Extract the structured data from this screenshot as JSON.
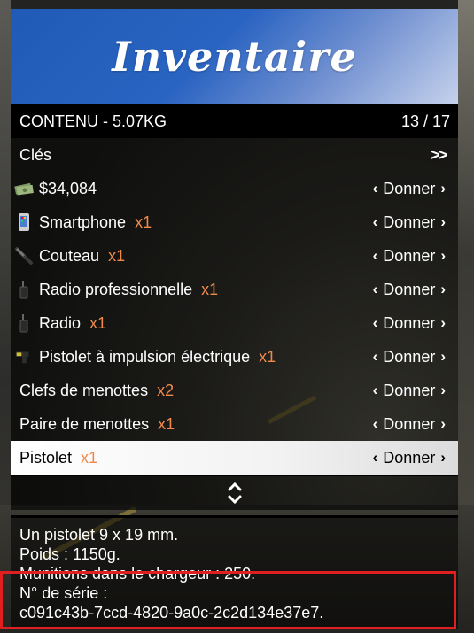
{
  "header": {
    "title": "Inventaire"
  },
  "subheader": {
    "label": "CONTENU - 5.07KG",
    "count": "13 / 17"
  },
  "rows": [
    {
      "label": "Clés",
      "qty": "",
      "icon": "",
      "action": ">>"
    },
    {
      "label": "$34,084",
      "qty": "",
      "icon": "cash-icon",
      "action": "Donner"
    },
    {
      "label": "Smartphone",
      "qty": "x1",
      "icon": "phone-icon",
      "action": "Donner"
    },
    {
      "label": "Couteau",
      "qty": "x1",
      "icon": "knife-icon",
      "action": "Donner"
    },
    {
      "label": "Radio professionnelle",
      "qty": "x1",
      "icon": "radio-icon",
      "action": "Donner"
    },
    {
      "label": "Radio",
      "qty": "x1",
      "icon": "radio-icon",
      "action": "Donner"
    },
    {
      "label": "Pistolet à impulsion électrique",
      "qty": "x1",
      "icon": "taser-icon",
      "action": "Donner"
    },
    {
      "label": "Clefs de menottes",
      "qty": "x2",
      "icon": "",
      "action": "Donner"
    },
    {
      "label": "Paire de menottes",
      "qty": "x1",
      "icon": "",
      "action": "Donner"
    },
    {
      "label": "Pistolet",
      "qty": "x1",
      "icon": "",
      "action": "Donner",
      "selected": true
    }
  ],
  "description": {
    "line1": "Un pistolet 9 x 19 mm.",
    "line2": "Poids : 1150g.",
    "line3": "Munitions dans le chargeur : 250.",
    "line4": "N° de série :",
    "line5": "c091c43b-7ccd-4820-9a0c-2c2d134e37e7."
  },
  "colors": {
    "header": "#2a64c2",
    "quantity": "#f08a4b",
    "highlight": "#e02020"
  }
}
